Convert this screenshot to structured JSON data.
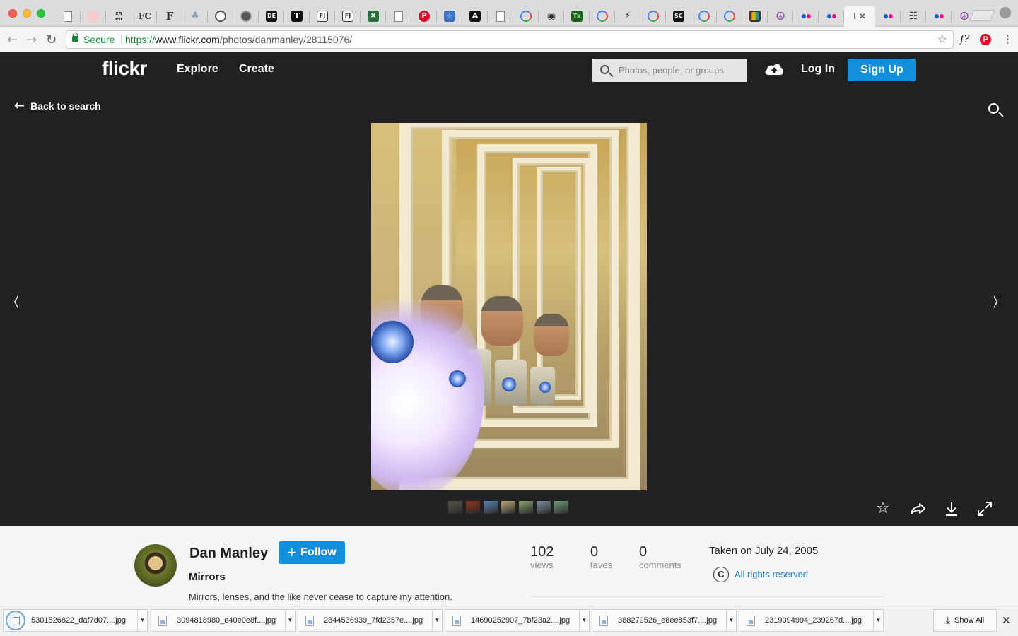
{
  "browser": {
    "tabs": [
      {
        "icon": "page-icon",
        "label": ""
      },
      {
        "icon": "pink-circle-icon",
        "label": ""
      },
      {
        "icon": "zh-en-icon",
        "label": "zh en"
      },
      {
        "icon": "fc-icon",
        "label": "FC"
      },
      {
        "icon": "f-icon",
        "label": "F"
      },
      {
        "icon": "tree-icon",
        "label": ""
      },
      {
        "icon": "gear-logo-icon",
        "label": ""
      },
      {
        "icon": "spiral-icon",
        "label": ""
      },
      {
        "icon": "de-icon",
        "label": "DE"
      },
      {
        "icon": "t-icon",
        "label": "T"
      },
      {
        "icon": "fj-icon",
        "label": "FJ"
      },
      {
        "icon": "fj-icon",
        "label": "FJ"
      },
      {
        "icon": "excel-icon",
        "label": ""
      },
      {
        "icon": "page-icon",
        "label": ""
      },
      {
        "icon": "pinterest-icon",
        "label": ""
      },
      {
        "icon": "bookmark-icon",
        "label": ""
      },
      {
        "icon": "a-icon",
        "label": "A"
      },
      {
        "icon": "page-icon",
        "label": ""
      },
      {
        "icon": "google-icon",
        "label": "G"
      },
      {
        "icon": "eye-icon",
        "label": ""
      },
      {
        "icon": "tk-icon",
        "label": "Tk"
      },
      {
        "icon": "google-icon",
        "label": "G"
      },
      {
        "icon": "bolt-icon",
        "label": ""
      },
      {
        "icon": "google-icon",
        "label": "G"
      },
      {
        "icon": "sc-icon",
        "label": "SC"
      },
      {
        "icon": "google-icon",
        "label": "G"
      },
      {
        "icon": "google-icon",
        "label": "G"
      },
      {
        "icon": "tv-icon",
        "label": ""
      },
      {
        "icon": "peace-icon",
        "label": ""
      },
      {
        "icon": "flickr-icon",
        "label": ""
      },
      {
        "icon": "flickr-icon",
        "label": ""
      },
      {
        "icon": "active-tab",
        "label": "I"
      },
      {
        "icon": "flickr-icon",
        "label": ""
      },
      {
        "icon": "trash-icon",
        "label": ""
      },
      {
        "icon": "flickr-icon",
        "label": ""
      },
      {
        "icon": "peace-icon",
        "label": ""
      }
    ],
    "secure_label": "Secure",
    "url_scheme": "https://",
    "url_host": "www.flickr.com",
    "url_path": "/photos/danmanley/28115076/"
  },
  "header": {
    "logo": "flickr",
    "nav": [
      "Explore",
      "Create"
    ],
    "search_placeholder": "Photos, people, or groups",
    "login": "Log In",
    "signup": "Sign Up"
  },
  "stage": {
    "back_label": "Back to search",
    "prev_glyph": "‹",
    "next_glyph": "›",
    "thumb_colors": [
      "#5a5548",
      "#8a3a22",
      "#5b84b0",
      "#b8a778",
      "#8aa070",
      "#7d8f9c",
      "#6e9a78"
    ]
  },
  "info": {
    "author": "Dan Manley",
    "follow_label": "Follow",
    "title": "Mirrors",
    "description": "Mirrors, lenses, and the like never cease to capture my attention.",
    "stats": [
      {
        "num": "102",
        "label": "views"
      },
      {
        "num": "0",
        "label": "faves"
      },
      {
        "num": "0",
        "label": "comments"
      }
    ],
    "taken": "Taken on July 24, 2005",
    "copyright_glyph": "C",
    "rights": "All rights reserved"
  },
  "downloads": {
    "items": [
      "5301526822_daf7d07....jpg",
      "3094818980_e40e0e8f....jpg",
      "2844536939_7fd2357e....jpg",
      "14690252907_7bf23a2....jpg",
      "388279526_e8ee853f7....jpg",
      "2319094994_239267d....jpg"
    ],
    "show_all": "Show All"
  },
  "colors": {
    "flickr_blue": "#128fdc",
    "flickr_dark": "#212124",
    "secure_green": "#138a36",
    "link_blue": "#1b7bc2"
  }
}
